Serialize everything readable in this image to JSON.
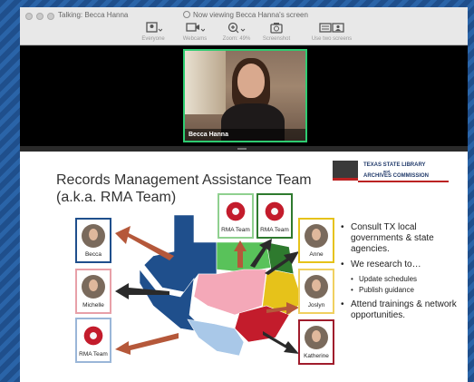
{
  "titlebar": {
    "talking": "Talking: Becca Hanna",
    "viewing": "Now viewing Becca Hanna's screen"
  },
  "toolbar": {
    "items": [
      {
        "label": "Everyone",
        "icon": "gallery-view-icon"
      },
      {
        "label": "Webcams",
        "icon": "camera-icon"
      },
      {
        "label": "Zoom: 49%",
        "icon": "zoom-in-icon"
      },
      {
        "label": "Screenshot",
        "icon": "screenshot-icon"
      },
      {
        "label": "Use two screens",
        "icon": "two-screens-icon"
      }
    ]
  },
  "camera": {
    "participant_name": "Becca Hanna",
    "border_color": "#2ecc71"
  },
  "slide": {
    "title_line1": "Records Management Assistance Team",
    "title_line2": "(a.k.a. RMA Team)",
    "logo_line1": "TEXAS STATE LIBRARY",
    "logo_line2": "and",
    "logo_line3": "ARCHIVES COMMISSION",
    "cards": [
      {
        "label": "Becca",
        "kind": "photo",
        "border": "#1f4f8c"
      },
      {
        "label": "Michelle",
        "kind": "photo",
        "border": "#e8a0a8"
      },
      {
        "label": "RMA Team",
        "kind": "logo",
        "border": "#9ab6d8"
      },
      {
        "label": "RMA Team",
        "kind": "logo",
        "border": "#8fd08f"
      },
      {
        "label": "RMA Team",
        "kind": "logo",
        "border": "#2e7a2e"
      },
      {
        "label": "Anne",
        "kind": "photo",
        "border": "#e6c21a"
      },
      {
        "label": "Joslyn",
        "kind": "photo",
        "border": "#f0d060"
      },
      {
        "label": "Katherine",
        "kind": "photo",
        "border": "#a01c2c"
      }
    ],
    "bullets": [
      {
        "text": "Consult TX local governments & state agencies.",
        "sub": []
      },
      {
        "text": "We research to…",
        "sub": [
          "Update schedules",
          "Publish guidance"
        ]
      },
      {
        "text": "Attend trainings & network opportunities.",
        "sub": []
      }
    ],
    "colors": {
      "region_blue": "#1f4f8c",
      "region_pink": "#f4a8b8",
      "region_green": "#59c25a",
      "region_darkgreen": "#2e7a2e",
      "region_yellow": "#e6c21a",
      "region_red": "#c31c2c",
      "region_lightblue": "#a9c8e8",
      "arrow_brown": "#b5583a",
      "arrow_black": "#2a2a2a"
    }
  }
}
